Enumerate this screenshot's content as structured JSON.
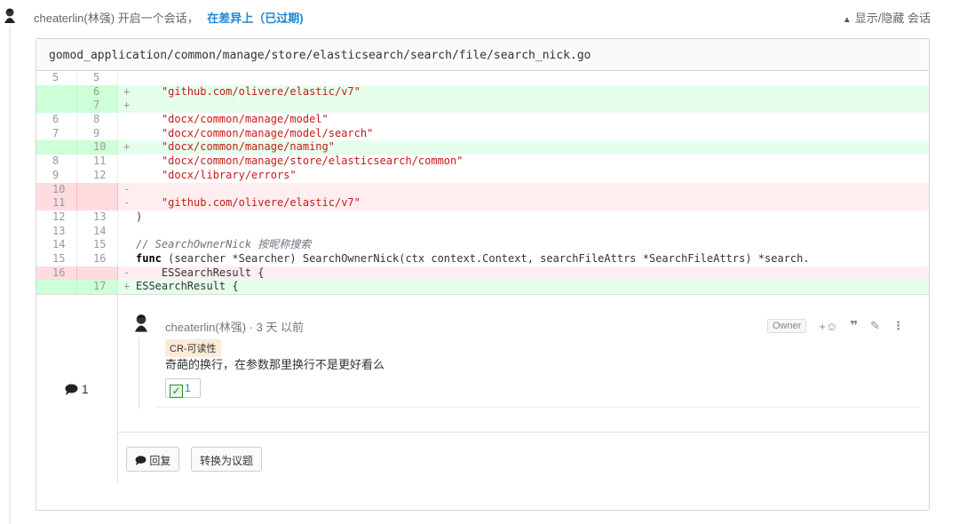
{
  "header": {
    "author": "cheaterlin(林强)",
    "action": "开启一个会话，",
    "target": "在差异上（已过期)",
    "toggle_label": "显示/隐藏 会话"
  },
  "file": {
    "path": "gomod_application/common/manage/store/elasticsearch/search/file/search_nick.go"
  },
  "diff": [
    {
      "type": "ctx",
      "old": "5",
      "new": "5",
      "sign": "",
      "code": ""
    },
    {
      "type": "add",
      "old": "",
      "new": "6",
      "sign": "+",
      "code": "    \"github.com/olivere/elastic/v7\""
    },
    {
      "type": "add",
      "old": "",
      "new": "7",
      "sign": "+",
      "code": ""
    },
    {
      "type": "ctx",
      "old": "6",
      "new": "8",
      "sign": "",
      "code": "    \"docx/common/manage/model\""
    },
    {
      "type": "ctx",
      "old": "7",
      "new": "9",
      "sign": "",
      "code": "    \"docx/common/manage/model/search\""
    },
    {
      "type": "add",
      "old": "",
      "new": "10",
      "sign": "+",
      "code": "    \"docx/common/manage/naming\""
    },
    {
      "type": "ctx",
      "old": "8",
      "new": "11",
      "sign": "",
      "code": "    \"docx/common/manage/store/elasticsearch/common\""
    },
    {
      "type": "ctx",
      "old": "9",
      "new": "12",
      "sign": "",
      "code": "    \"docx/library/errors\""
    },
    {
      "type": "del",
      "old": "10",
      "new": "",
      "sign": "-",
      "code": ""
    },
    {
      "type": "del",
      "old": "11",
      "new": "",
      "sign": "-",
      "code": "    \"github.com/olivere/elastic/v7\""
    },
    {
      "type": "ctx",
      "old": "12",
      "new": "13",
      "sign": "",
      "code": ")"
    },
    {
      "type": "ctx",
      "old": "13",
      "new": "14",
      "sign": "",
      "code": ""
    },
    {
      "type": "ctx",
      "old": "14",
      "new": "15",
      "sign": "",
      "code": "// SearchOwnerNick 按昵称搜索"
    },
    {
      "type": "ctx",
      "old": "15",
      "new": "16",
      "sign": "",
      "code": "func (searcher *Searcher) SearchOwnerNick(ctx context.Context, searchFileAttrs *SearchFileAttrs) *search."
    },
    {
      "type": "del",
      "old": "16",
      "new": "",
      "sign": "-",
      "code": "    ESSearchResult {"
    },
    {
      "type": "add",
      "old": "",
      "new": "17",
      "sign": "+",
      "code": "ESSearchResult {"
    }
  ],
  "conversation": {
    "count": "1",
    "comment": {
      "author": "cheaterlin(林强)",
      "time": " · 3 天 以前",
      "label": "CR-可读性",
      "body": "奇葩的换行，在参数那里换行不是更好看么",
      "reaction_count": "1",
      "owner_label": "Owner"
    },
    "reply_label": "回复",
    "convert_label": "转换为议题"
  }
}
